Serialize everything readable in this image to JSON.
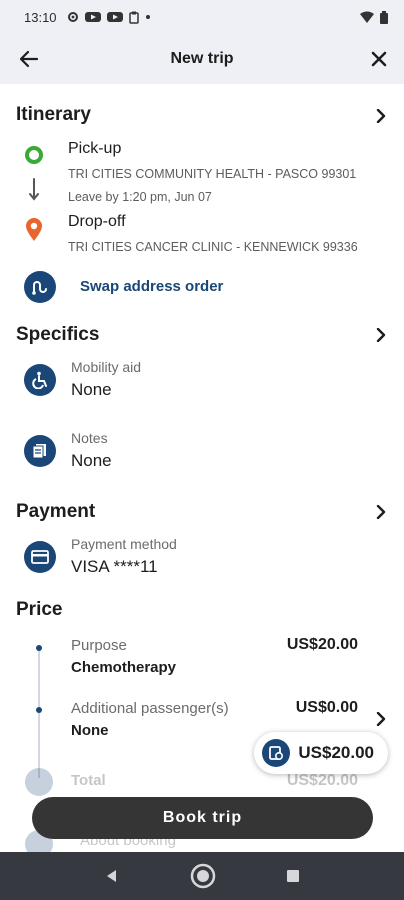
{
  "status_bar": {
    "time": "13:10"
  },
  "app_bar": {
    "title": "New trip"
  },
  "itinerary": {
    "title": "Itinerary",
    "pickup_label": "Pick-up",
    "pickup_address": "TRI CITIES COMMUNITY HEALTH - PASCO 99301",
    "leave_by": "Leave by 1:20 pm, Jun 07",
    "dropoff_label": "Drop-off",
    "dropoff_address": "TRI CITIES CANCER CLINIC - KENNEWICK 99336",
    "swap_label": "Swap address order"
  },
  "specifics": {
    "title": "Specifics",
    "mobility_label": "Mobility aid",
    "mobility_value": "None",
    "notes_label": "Notes",
    "notes_value": "None"
  },
  "payment": {
    "title": "Payment",
    "method_label": "Payment method",
    "method_value": "VISA ****11"
  },
  "price": {
    "title": "Price",
    "purpose_label": "Purpose",
    "purpose_value": "Chemotherapy",
    "purpose_amount": "US$20.00",
    "passengers_label": "Additional passenger(s)",
    "passengers_value": "None",
    "passengers_amount": "US$0.00",
    "total_label": "Total",
    "total_amount": "US$20.00",
    "about_label": "About booking"
  },
  "total_pill": {
    "amount": "US$20.00"
  },
  "book_button": {
    "label": "Book trip"
  },
  "colors": {
    "accent": "#1a4778",
    "pickup": "#3aa935",
    "dropoff": "#e8652c",
    "button": "#353535"
  }
}
